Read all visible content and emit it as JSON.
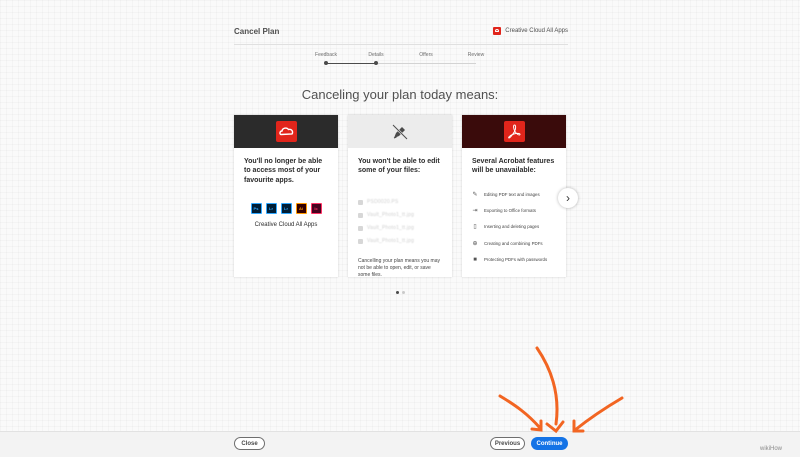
{
  "header": {
    "title": "Cancel Plan",
    "product": "Creative Cloud All Apps"
  },
  "stepper": {
    "steps": [
      "Feedback",
      "Details",
      "Offers",
      "Review"
    ],
    "current_step": "Details"
  },
  "headline": "Canceling your plan today means:",
  "cards": {
    "cc": {
      "icon": "creative-cloud-icon",
      "title": "You'll no longer be able to access most of your favourite apps.",
      "apps": [
        {
          "abbr": "Ps",
          "bg": "#001e36",
          "fg": "#31a8ff"
        },
        {
          "abbr": "Lr",
          "bg": "#001e36",
          "fg": "#31a8ff"
        },
        {
          "abbr": "Lr",
          "bg": "#001e36",
          "fg": "#31a8ff"
        },
        {
          "abbr": "Ai",
          "bg": "#330000",
          "fg": "#ff9a00"
        },
        {
          "abbr": "Ic",
          "bg": "#49021f",
          "fg": "#ff3366"
        }
      ],
      "app_label": "Creative Cloud All Apps"
    },
    "files": {
      "icon": "broken-pen-icon",
      "title": "You won't be able to edit some of your files:",
      "files": [
        "PSD0020.PS",
        "Vault_Photo1_tt.jpg",
        "Vault_Photo1_tt.jpg",
        "Vault_Photo1_tt.jpg"
      ],
      "note": "Cancelling your plan means you may not be able to open, edit, or save some files."
    },
    "acrobat": {
      "icon": "acrobat-icon",
      "title": "Several Acrobat features will be unavailable:",
      "features": [
        {
          "icon": "pencil-icon",
          "label": "Editing PDF text and images"
        },
        {
          "icon": "export-icon",
          "label": "Exporting to Office formats"
        },
        {
          "icon": "insert-page-icon",
          "label": "Inserting and deleting pages"
        },
        {
          "icon": "combine-icon",
          "label": "Creating and combining PDFs"
        },
        {
          "icon": "lock-icon",
          "label": "Protecting PDFs with passwords"
        }
      ]
    }
  },
  "pager": {
    "count": 2,
    "active": 1
  },
  "footer": {
    "close_label": "Close",
    "previous_label": "Previous",
    "continue_label": "Continue"
  },
  "watermark": "wikiHow",
  "colors": {
    "accent": "#1473e6",
    "adobe_red": "#e1251b",
    "arrow": "#f26522",
    "card_header_dark": "#2b2b2b",
    "acrobat_header": "#3a0b0b"
  }
}
